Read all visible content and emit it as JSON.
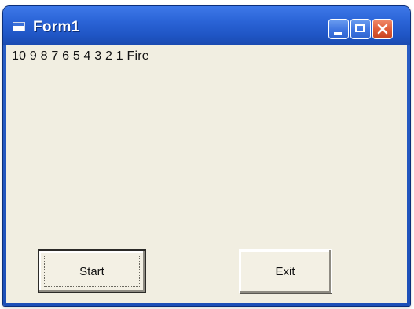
{
  "window": {
    "title": "Form1",
    "app_icon": "form-icon",
    "controls": {
      "minimize": "minimize-icon",
      "maximize": "maximize-icon",
      "close": "close-icon"
    }
  },
  "content": {
    "countdown_text": "10 9 8 7 6 5 4 3 2 1 Fire"
  },
  "buttons": {
    "start_label": "Start",
    "exit_label": "Exit"
  },
  "colors": {
    "titlebar": "#2a63d6",
    "close_button": "#de5a35",
    "client_background": "#f1eee1"
  }
}
